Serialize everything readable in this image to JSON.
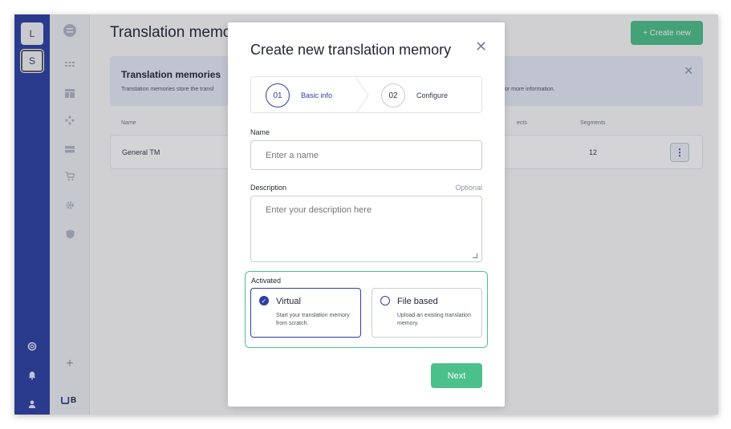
{
  "rail": {
    "workspaces": [
      "L",
      "S"
    ],
    "bottom_icons": [
      "help-icon",
      "bell-icon",
      "user-icon"
    ]
  },
  "sidebar": {
    "icons": [
      "dashboard-icon",
      "projects-icon",
      "table-icon",
      "connections-icon",
      "memory-icon",
      "cart-icon",
      "settings-icon",
      "shield-icon"
    ],
    "add_label": "+",
    "logo": "B"
  },
  "page": {
    "title": "Translation memo",
    "create_button": "+ Create new",
    "banner": {
      "title": "Translation memories",
      "text_left": "Translation memories store the transl",
      "text_right": "for more information."
    },
    "table": {
      "headers": [
        "Name",
        "ects",
        "Segments"
      ],
      "rows": [
        {
          "name": "General TM",
          "segments": "12"
        }
      ]
    }
  },
  "modal": {
    "title": "Create new translation memory",
    "steps": [
      {
        "number": "01",
        "label": "Basic info",
        "active": true
      },
      {
        "number": "02",
        "label": "Configure",
        "active": false
      }
    ],
    "name_label": "Name",
    "name_placeholder": "Enter a name",
    "description_label": "Description",
    "description_optional": "Optional",
    "description_placeholder": "Enter your description here",
    "activated_label": "Activated",
    "options": [
      {
        "title": "Virtual",
        "description": "Start your translation memory from scratch.",
        "selected": true
      },
      {
        "title": "File based",
        "description": "Upload an existing translation memory.",
        "selected": false
      }
    ],
    "next_button": "Next"
  },
  "colors": {
    "brand_blue": "#2b40a4",
    "accent_green": "#4cc08a"
  }
}
